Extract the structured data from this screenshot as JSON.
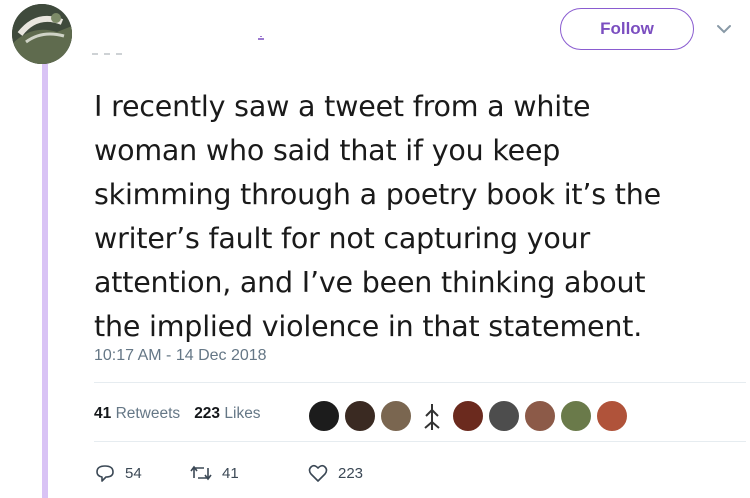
{
  "header": {
    "display_name": "",
    "handle": "",
    "follow_label": "Follow",
    "accent_color": "#7b4ec0",
    "thread_line_color": "#d9c3f5"
  },
  "tweet": {
    "lines": [
      "I recently saw a tweet from a white",
      "woman who said that if you keep",
      "skimming through a poetry book it’s the",
      "writer’s fault for not capturing your",
      "attention, and I’ve been thinking about",
      "the implied violence in that statement."
    ],
    "timestamp": "10:17 AM - 14 Dec 2018"
  },
  "stats": {
    "retweets_count": "41",
    "retweets_label": "Retweets",
    "likes_count": "223",
    "likes_label": "Likes",
    "liker_avatar_colors": [
      "#1c1c1c",
      "#3a2a22",
      "#7a6650",
      "#ffffff",
      "#6b2a1e",
      "#4d4d4d",
      "#8c5a48",
      "#6a7a4a",
      "#b0533a"
    ]
  },
  "actions": {
    "reply_count": "54",
    "retweet_count": "41",
    "like_count": "223"
  }
}
